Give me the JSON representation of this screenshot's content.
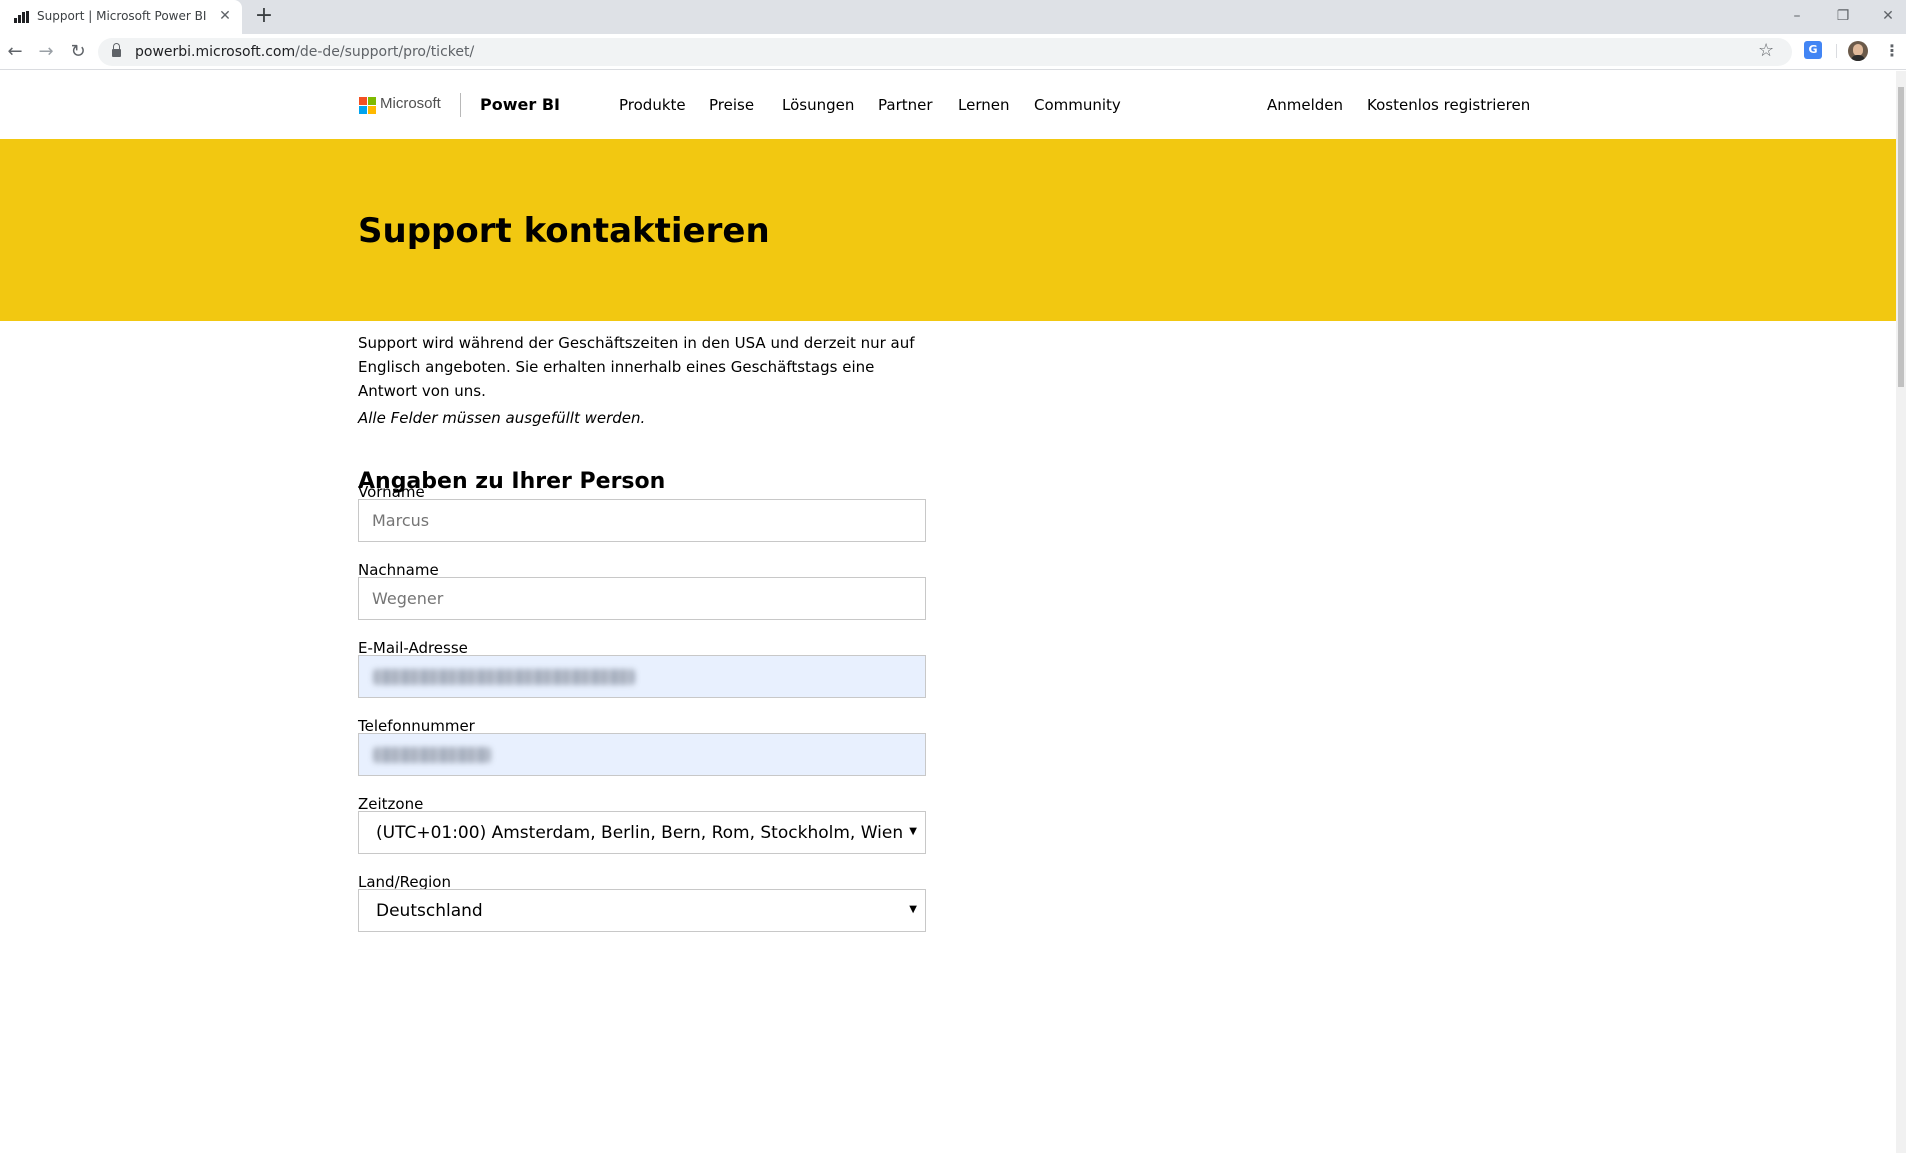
{
  "browser": {
    "tab_title": "Support | Microsoft Power BI",
    "tab_close": "✕",
    "new_tab": "+",
    "url_host": "powerbi.microsoft.com",
    "url_path": "/de-de/support/pro/ticket/",
    "window_controls": {
      "minimize": "–",
      "restore": "❐",
      "close": "✕"
    },
    "back": "←",
    "forward": "→",
    "reload": "↻",
    "star": "☆",
    "translate_label": "G",
    "menu": "⋮"
  },
  "header": {
    "ms_label": "Microsoft",
    "brand": "Power BI",
    "nav": [
      "Produkte",
      "Preise",
      "Lösungen",
      "Partner",
      "Lernen",
      "Community"
    ],
    "signin": "Anmelden",
    "register": "Kostenlos registrieren"
  },
  "banner": {
    "title": "Support kontaktieren",
    "color": "#f2c811"
  },
  "intro": {
    "text": "Support wird während der Geschäftszeiten in den USA und derzeit nur auf Englisch angeboten. Sie erhalten innerhalb eines Geschäftstags eine Antwort von uns.",
    "note": "Alle Felder müssen ausgefüllt werden."
  },
  "form": {
    "section_title": "Angaben zu Ihrer Person",
    "first_name": {
      "label": "Vorname",
      "value": "Marcus"
    },
    "last_name": {
      "label": "Nachname",
      "value": "Wegener"
    },
    "email": {
      "label": "E-Mail-Adresse"
    },
    "phone": {
      "label": "Telefonnummer"
    },
    "timezone": {
      "label": "Zeitzone",
      "value": "(UTC+01:00) Amsterdam, Berlin, Bern, Rom, Stockholm, Wien"
    },
    "country": {
      "label": "Land/Region",
      "value": "Deutschland"
    },
    "select_arrow": "▼"
  },
  "icons": {
    "tab_favicon": "bar-chart-icon",
    "lock": "lock-icon",
    "ms_logo": "microsoft-logo-icon",
    "avatar": "profile-avatar-icon"
  },
  "colors": {
    "ms_red": "#f25022",
    "ms_green": "#7fba00",
    "ms_blue": "#00a4ef",
    "ms_yellow": "#ffb900",
    "autofill": "#e8f0fe"
  }
}
